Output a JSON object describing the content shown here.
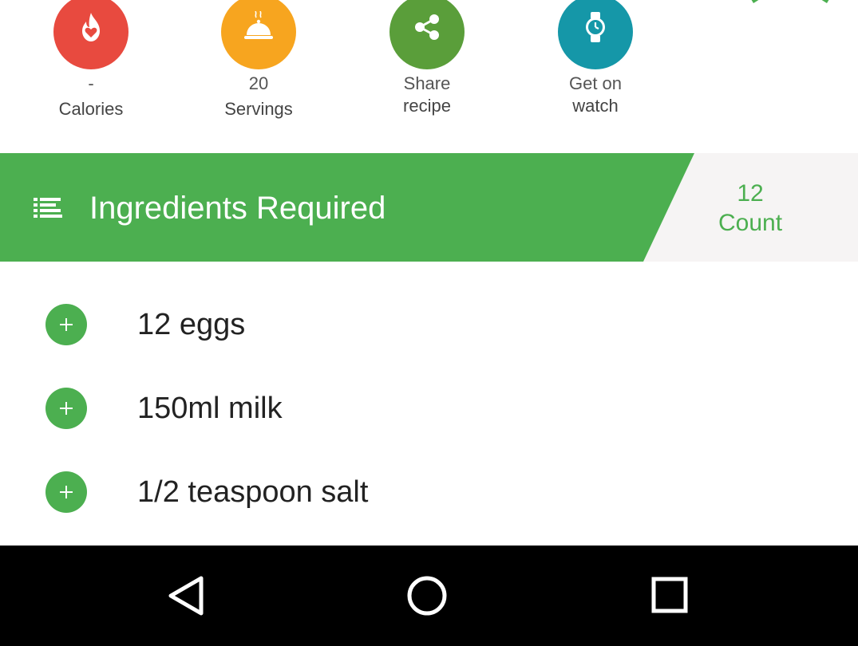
{
  "actions": {
    "calories": {
      "value": "-",
      "label": "Calories",
      "icon": "flame-heart-icon",
      "color": "#e84a3f"
    },
    "servings": {
      "value": "20",
      "label": "Servings",
      "icon": "cloche-icon",
      "color": "#f7a51f"
    },
    "share": {
      "line1": "Share",
      "line2": "recipe",
      "icon": "share-icon",
      "color": "#5a9e3a"
    },
    "watch": {
      "line1": "Get on",
      "line2": "watch",
      "icon": "watch-icon",
      "color": "#1597a8"
    }
  },
  "ingredients_header": {
    "title": "Ingredients Required",
    "count": "12",
    "count_label": "Count",
    "icon": "list-icon",
    "accent_color": "#4caf50"
  },
  "ingredients": [
    {
      "text": "12 eggs"
    },
    {
      "text": "150ml milk"
    },
    {
      "text": "1/2 teaspoon salt"
    }
  ],
  "navbar": {
    "back_icon": "back-triangle-icon",
    "home_icon": "home-circle-icon",
    "recent_icon": "recent-square-icon"
  }
}
